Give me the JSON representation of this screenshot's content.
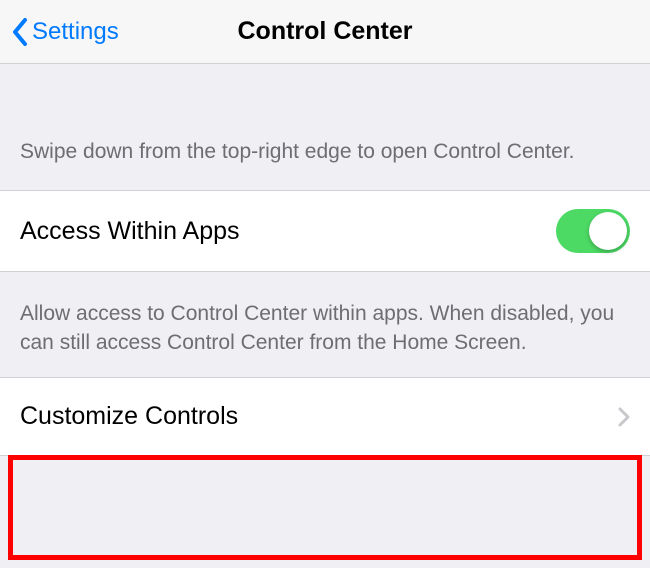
{
  "header": {
    "back_label": "Settings",
    "title": "Control Center"
  },
  "intro_text": "Swipe down from the top-right edge to open Control Center.",
  "access_row": {
    "label": "Access Within Apps",
    "toggle_on": true
  },
  "access_desc": "Allow access to Control Center within apps. When disabled, you can still access Control Center from the Home Screen.",
  "customize_row": {
    "label": "Customize Controls"
  }
}
